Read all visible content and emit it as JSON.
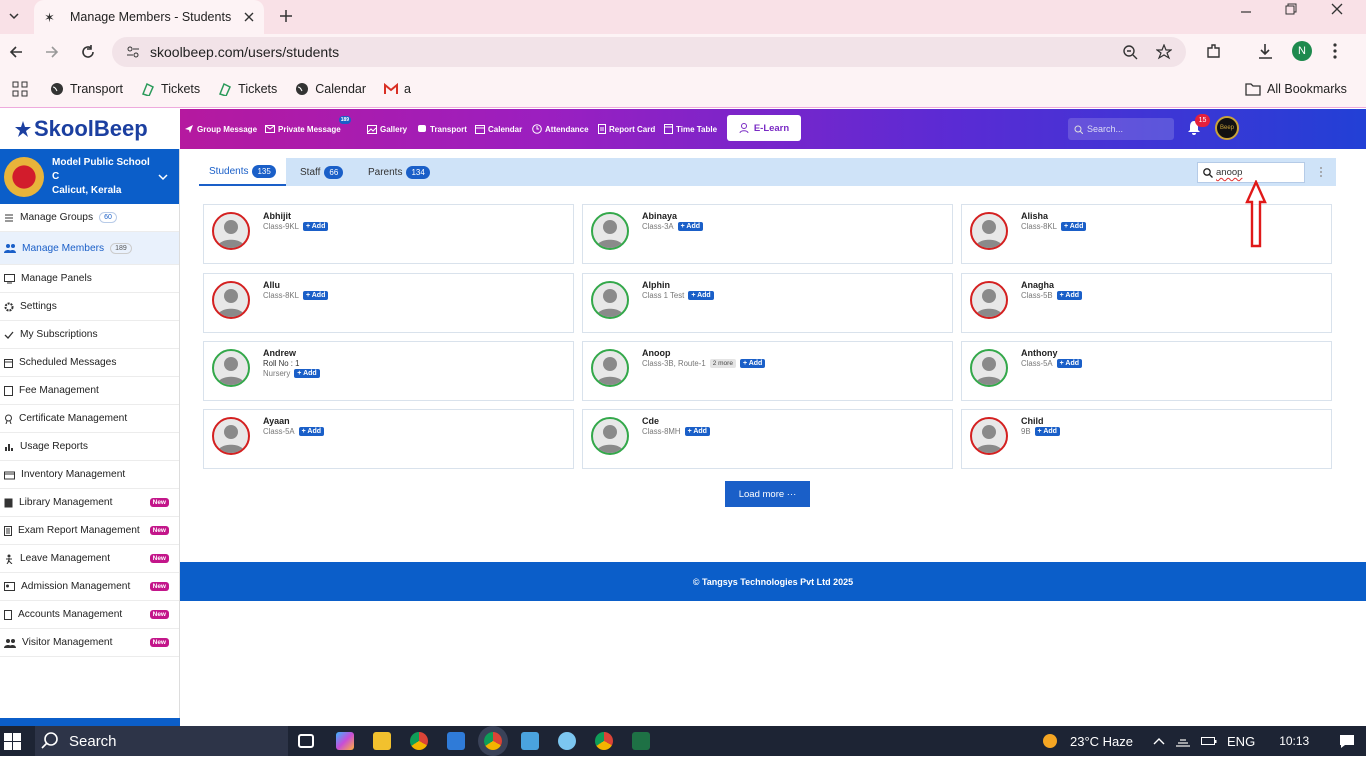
{
  "browser": {
    "tab_title": "Manage Members - Students",
    "url": "skoolbeep.com/users/students",
    "bookmarks": [
      "Transport",
      "Tickets",
      "Tickets",
      "Calendar",
      "a"
    ],
    "all_bookmarks": "All Bookmarks",
    "profile_initial": "N"
  },
  "app": {
    "logo_text": "SkoolBeep",
    "nav": [
      {
        "label": "Group Message",
        "icon": "send-icon"
      },
      {
        "label": "Private Message",
        "icon": "mail-icon",
        "badge": "189"
      },
      {
        "label": "Gallery",
        "icon": "image-icon"
      },
      {
        "label": "Transport",
        "icon": "bus-icon"
      },
      {
        "label": "Calendar",
        "icon": "calendar-icon"
      },
      {
        "label": "Attendance",
        "icon": "clock-icon"
      },
      {
        "label": "Report Card",
        "icon": "document-icon"
      },
      {
        "label": "Time Table",
        "icon": "timetable-icon"
      }
    ],
    "elearn": "E-Learn",
    "search_placeholder": "Search...",
    "notification_count": "15",
    "avatar_text": "Beep"
  },
  "sidebar": {
    "school_name": "Model Public School C",
    "school_location": "Calicut, Kerala",
    "items": [
      {
        "label": "Manage Groups",
        "count": "60"
      },
      {
        "label": "Manage Members",
        "count": "189",
        "active": true
      },
      {
        "label": "Manage Panels"
      },
      {
        "label": "Settings"
      },
      {
        "label": "My Subscriptions"
      },
      {
        "label": "Scheduled Messages"
      },
      {
        "label": "Fee Management"
      },
      {
        "label": "Certificate Management"
      },
      {
        "label": "Usage Reports"
      },
      {
        "label": "Inventory Management"
      },
      {
        "label": "Library Management",
        "new": "New"
      },
      {
        "label": "Exam Report Management",
        "new": "New"
      },
      {
        "label": "Leave Management",
        "new": "New"
      },
      {
        "label": "Admission Management",
        "new": "New"
      },
      {
        "label": "Accounts Management",
        "new": "New"
      },
      {
        "label": "Visitor Management",
        "new": "New"
      }
    ]
  },
  "main": {
    "tabs": [
      {
        "label": "Students",
        "count": "135"
      },
      {
        "label": "Staff",
        "count": "66"
      },
      {
        "label": "Parents",
        "count": "134"
      }
    ],
    "search_value": "anoop",
    "add_label": "+ Add",
    "members": [
      {
        "name": "Abhijit",
        "class": "Class-9KL",
        "status": "red"
      },
      {
        "name": "Abinaya",
        "class": "Class-3A",
        "status": "green"
      },
      {
        "name": "Alisha",
        "class": "Class-8KL",
        "status": "red"
      },
      {
        "name": "Allu",
        "class": "Class-8KL",
        "status": "red"
      },
      {
        "name": "Alphin",
        "class": "Class 1 Test",
        "status": "green"
      },
      {
        "name": "Anagha",
        "class": "Class-5B",
        "status": "red"
      },
      {
        "name": "Andrew",
        "roll": "Roll No : 1",
        "class": "Nursery",
        "status": "green"
      },
      {
        "name": "Anoop",
        "class": "Class-3B, Route-1",
        "more": "2 more",
        "status": "green"
      },
      {
        "name": "Anthony",
        "class": "Class-5A",
        "status": "green"
      },
      {
        "name": "Ayaan",
        "class": "Class-5A",
        "status": "red"
      },
      {
        "name": "Cde",
        "class": "Class-8MH",
        "status": "green"
      },
      {
        "name": "Child",
        "class": "9B",
        "status": "red"
      }
    ],
    "load_more": "Load more ···",
    "footer": "© Tangsys Technologies Pvt Ltd 2025"
  },
  "taskbar": {
    "search": "Search",
    "weather": "23°C  Haze",
    "lang": "ENG",
    "time": "10:13"
  }
}
